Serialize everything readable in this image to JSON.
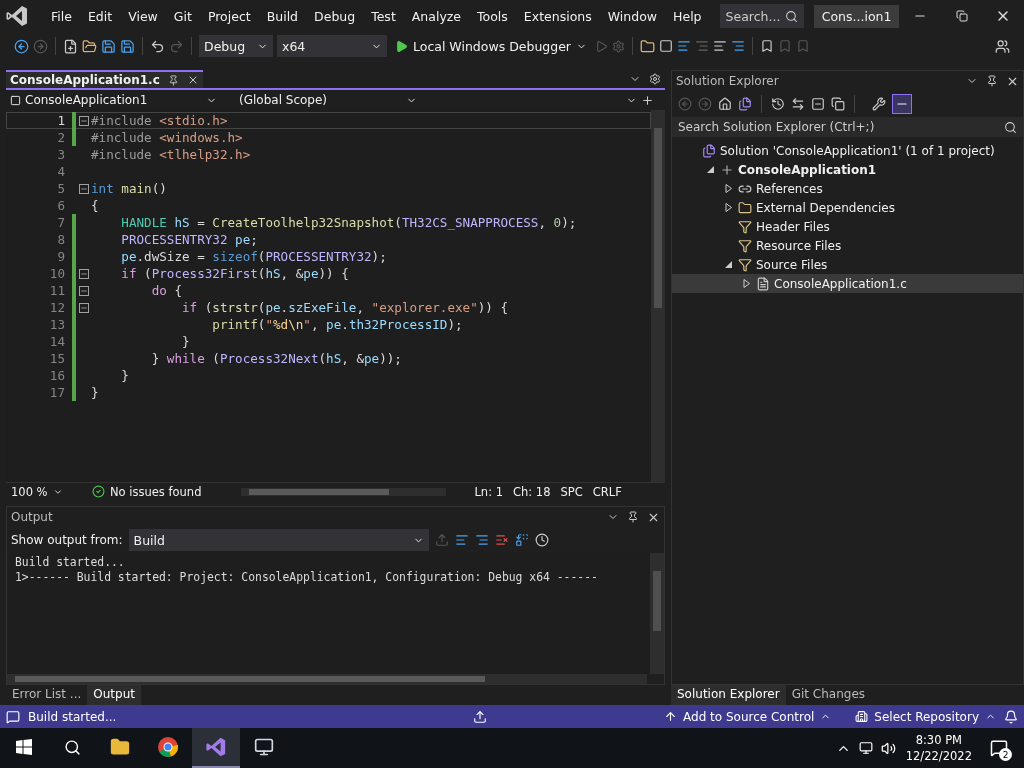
{
  "menu": [
    "File",
    "Edit",
    "View",
    "Git",
    "Project",
    "Build",
    "Debug",
    "Test",
    "Analyze",
    "Tools",
    "Extensions",
    "Window",
    "Help"
  ],
  "search": {
    "placeholder": "Search..."
  },
  "solution_name": "Cons...ion1",
  "toolbar": {
    "configuration": "Debug",
    "platform": "x64",
    "debugger": "Local Windows Debugger"
  },
  "editor": {
    "tab": {
      "label": "ConsoleApplication1.c",
      "selected": true
    },
    "project_scope": "ConsoleApplication1",
    "global_scope": "(Global Scope)",
    "lines": [
      {
        "number": "1",
        "current": true,
        "changed": true,
        "foldable": true,
        "tokens": [
          {
            "kind": "pre",
            "text": "#include "
          },
          {
            "kind": "str",
            "text": "<stdio.h>"
          }
        ]
      },
      {
        "number": "2",
        "current": false,
        "changed": true,
        "foldable": false,
        "tokens": [
          {
            "kind": "pre",
            "text": "#include "
          },
          {
            "kind": "str",
            "text": "<windows.h>"
          }
        ]
      },
      {
        "number": "3",
        "current": false,
        "changed": false,
        "foldable": false,
        "tokens": [
          {
            "kind": "pre",
            "text": "#include "
          },
          {
            "kind": "str",
            "text": "<tlhelp32.h>"
          }
        ]
      },
      {
        "number": "4",
        "current": false,
        "changed": false,
        "foldable": false
      },
      {
        "number": "5",
        "current": false,
        "changed": false,
        "foldable": true,
        "tokens": [
          {
            "kind": "kw",
            "text": "int "
          },
          {
            "kind": "fn",
            "text": "main"
          },
          {
            "kind": "plain",
            "text": "()"
          }
        ]
      },
      {
        "number": "6",
        "current": false,
        "changed": false,
        "foldable": false,
        "tokens": [
          {
            "kind": "plain",
            "text": "{"
          }
        ]
      },
      {
        "number": "7",
        "current": false,
        "changed": true,
        "foldable": false,
        "tokens": [
          {
            "kind": "type",
            "text": "    HANDLE "
          },
          {
            "kind": "var",
            "text": "hS"
          },
          {
            "kind": "plain",
            "text": " = "
          },
          {
            "kind": "fn",
            "text": "CreateToolhelp32Snapshot"
          },
          {
            "kind": "plain",
            "text": "("
          },
          {
            "kind": "macro",
            "text": "TH32CS_SNAPPROCESS"
          },
          {
            "kind": "plain",
            "text": ", "
          },
          {
            "kind": "num",
            "text": "0"
          },
          {
            "kind": "plain",
            "text": ");"
          }
        ]
      },
      {
        "number": "8",
        "current": false,
        "changed": true,
        "foldable": false,
        "tokens": [
          {
            "kind": "macro",
            "text": "    PROCESSENTRY32 "
          },
          {
            "kind": "var",
            "text": "pe"
          },
          {
            "kind": "plain",
            "text": ";"
          }
        ]
      },
      {
        "number": "9",
        "current": false,
        "changed": true,
        "foldable": false,
        "tokens": [
          {
            "kind": "var",
            "text": "    pe"
          },
          {
            "kind": "plain",
            "text": ".dwSize = "
          },
          {
            "kind": "kw",
            "text": "sizeof"
          },
          {
            "kind": "plain",
            "text": "("
          },
          {
            "kind": "macro",
            "text": "PROCESSENTRY32"
          },
          {
            "kind": "plain",
            "text": ");"
          }
        ]
      },
      {
        "number": "10",
        "current": false,
        "changed": true,
        "foldable": true,
        "tokens": [
          {
            "kind": "ctl",
            "text": "    if"
          },
          {
            "kind": "plain",
            "text": " ("
          },
          {
            "kind": "macro",
            "text": "Process32First"
          },
          {
            "kind": "plain",
            "text": "("
          },
          {
            "kind": "var",
            "text": "hS"
          },
          {
            "kind": "plain",
            "text": ", &"
          },
          {
            "kind": "var",
            "text": "pe"
          },
          {
            "kind": "plain",
            "text": ")) {"
          }
        ]
      },
      {
        "number": "11",
        "current": false,
        "changed": true,
        "foldable": true,
        "tokens": [
          {
            "kind": "ctl",
            "text": "        do"
          },
          {
            "kind": "plain",
            "text": " {"
          }
        ]
      },
      {
        "number": "12",
        "current": false,
        "changed": true,
        "foldable": true,
        "tokens": [
          {
            "kind": "ctl",
            "text": "            if"
          },
          {
            "kind": "plain",
            "text": " ("
          },
          {
            "kind": "fn",
            "text": "strstr"
          },
          {
            "kind": "plain",
            "text": "("
          },
          {
            "kind": "var",
            "text": "pe"
          },
          {
            "kind": "plain",
            "text": "."
          },
          {
            "kind": "var",
            "text": "szExeFile"
          },
          {
            "kind": "plain",
            "text": ", "
          },
          {
            "kind": "str",
            "text": "\"explorer.exe\""
          },
          {
            "kind": "plain",
            "text": ")) {"
          }
        ]
      },
      {
        "number": "13",
        "current": false,
        "changed": true,
        "foldable": false,
        "tokens": [
          {
            "kind": "fn",
            "text": "                printf"
          },
          {
            "kind": "plain",
            "text": "("
          },
          {
            "kind": "str",
            "text": "\""
          },
          {
            "kind": "esc",
            "text": "%d\\n"
          },
          {
            "kind": "str",
            "text": "\""
          },
          {
            "kind": "plain",
            "text": ", "
          },
          {
            "kind": "var",
            "text": "pe"
          },
          {
            "kind": "plain",
            "text": "."
          },
          {
            "kind": "var",
            "text": "th32ProcessID"
          },
          {
            "kind": "plain",
            "text": ");"
          }
        ]
      },
      {
        "number": "14",
        "current": false,
        "changed": true,
        "foldable": false,
        "tokens": [
          {
            "kind": "plain",
            "text": "            }"
          }
        ]
      },
      {
        "number": "15",
        "current": false,
        "changed": true,
        "foldable": false,
        "tokens": [
          {
            "kind": "plain",
            "text": "        } "
          },
          {
            "kind": "ctl",
            "text": "while"
          },
          {
            "kind": "plain",
            "text": " ("
          },
          {
            "kind": "macro",
            "text": "Process32Next"
          },
          {
            "kind": "plain",
            "text": "("
          },
          {
            "kind": "var",
            "text": "hS"
          },
          {
            "kind": "plain",
            "text": ", &"
          },
          {
            "kind": "var",
            "text": "pe"
          },
          {
            "kind": "plain",
            "text": "));"
          }
        ]
      },
      {
        "number": "16",
        "current": false,
        "changed": true,
        "foldable": false,
        "tokens": [
          {
            "kind": "plain",
            "text": "    }"
          }
        ]
      },
      {
        "number": "17",
        "current": false,
        "changed": true,
        "foldable": false,
        "tokens": [
          {
            "kind": "plain",
            "text": "}"
          }
        ]
      }
    ]
  },
  "editor_status": {
    "zoom": "100 %",
    "issues": "No issues found",
    "line": "Ln: 1",
    "column": "Ch: 18",
    "whitespace": "SPC",
    "line_endings": "CRLF"
  },
  "output": {
    "title": "Output",
    "source_label": "Show output from:",
    "source": "Build",
    "lines": [
      "Build started...",
      "1>------ Build started: Project: ConsoleApplication1, Configuration: Debug x64 ------"
    ]
  },
  "bottom_tabs": [
    {
      "label": "Error List ...",
      "selected": false
    },
    {
      "label": "Output",
      "selected": true
    }
  ],
  "solution_explorer": {
    "title": "Solution Explorer",
    "search": {
      "placeholder": "Search Solution Explorer (Ctrl+;)"
    },
    "tree": [
      {
        "label": "Solution 'ConsoleApplication1' (1 of 1 project)",
        "kind": "solution",
        "selected": false,
        "children": [
          {
            "label": "ConsoleApplication1",
            "kind": "project",
            "expanded": true,
            "selected": false,
            "children": [
              {
                "label": "References",
                "kind": "references",
                "expanded": false,
                "selected": false
              },
              {
                "label": "External Dependencies",
                "kind": "external",
                "expanded": false,
                "selected": false
              },
              {
                "label": "Header Files",
                "kind": "filter",
                "selected": false
              },
              {
                "label": "Resource Files",
                "kind": "filter",
                "selected": false
              },
              {
                "label": "Source Files",
                "kind": "filter",
                "expanded": true,
                "selected": false,
                "children": [
                  {
                    "label": "ConsoleApplication1.c",
                    "kind": "file",
                    "expanded": false,
                    "selected": true
                  }
                ]
              }
            ]
          }
        ]
      }
    ]
  },
  "right_tabs": [
    {
      "label": "Solution Explorer",
      "selected": true
    },
    {
      "label": "Git Changes",
      "selected": false
    }
  ],
  "status_bar": {
    "message": "Build started...",
    "source_control": "Add to Source Control",
    "repository": "Select Repository"
  },
  "taskbar": {
    "time": "8:30 PM",
    "date": "12/22/2022",
    "notifications": "2"
  }
}
